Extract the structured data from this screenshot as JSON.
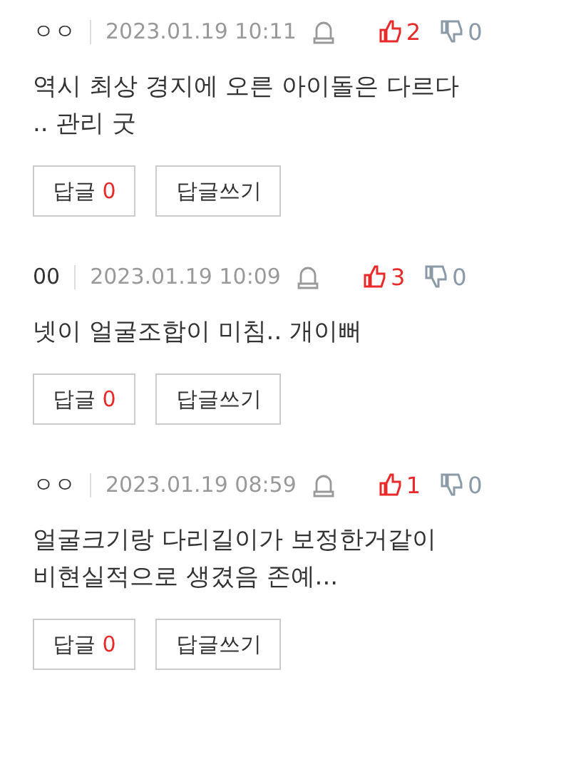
{
  "comments": [
    {
      "author": "ㅇㅇ",
      "date": "2023.01.19 10:11",
      "likes": "2",
      "dislikes": "0",
      "text": "역시 최상 경지에 오른 아이돌은 다르다\n.. 관리 굿",
      "reply_label": "답글",
      "reply_count": "0",
      "write_label": "답글쓰기"
    },
    {
      "author": "00",
      "date": "2023.01.19 10:09",
      "likes": "3",
      "dislikes": "0",
      "text": "넷이 얼굴조합이 미침.. 개이뻐",
      "reply_label": "답글",
      "reply_count": "0",
      "write_label": "답글쓰기"
    },
    {
      "author": "ㅇㅇ",
      "date": "2023.01.19 08:59",
      "likes": "1",
      "dislikes": "0",
      "text": "얼굴크기랑 다리길이가 보정한거같이\n비현실적으로 생겼음 존예...",
      "reply_label": "답글",
      "reply_count": "0",
      "write_label": "답글쓰기"
    }
  ]
}
